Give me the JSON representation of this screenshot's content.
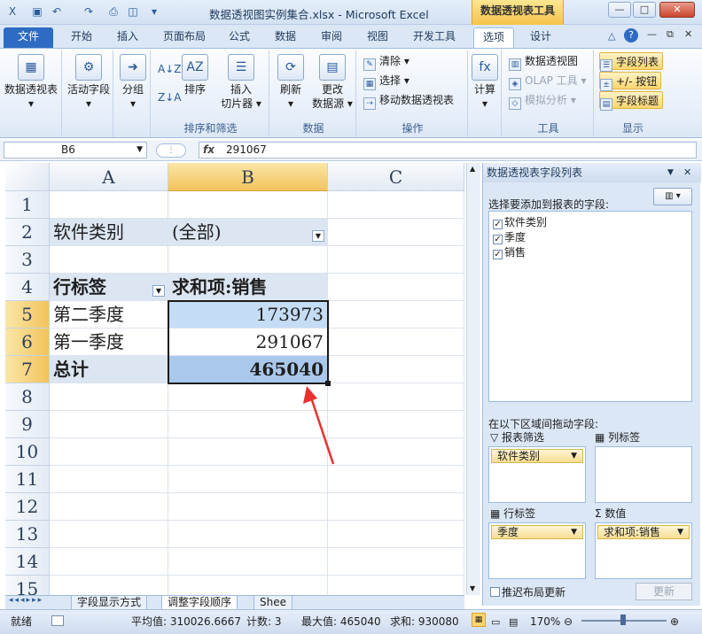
{
  "titlebar": {
    "title": "数据透视图实例集合.xlsx - Microsoft Excel",
    "context_tab": "数据透视表工具",
    "win_min": "—",
    "win_max": "□",
    "win_close": "✕"
  },
  "tabs": {
    "file": "文件",
    "home": "开始",
    "insert": "插入",
    "page_layout": "页面布局",
    "formulas": "公式",
    "data": "数据",
    "review": "审阅",
    "view": "视图",
    "developer": "开发工具",
    "options": "选项",
    "design": "设计"
  },
  "ribbon": {
    "pivottable": "数据透视表",
    "active_field": "活动字段",
    "group": "分组",
    "sort": "排序",
    "insert_slicer": [
      "插入",
      "切片器"
    ],
    "refresh": "刷新",
    "change_source": [
      "更改",
      "数据源"
    ],
    "clear": "清除",
    "select": "选择",
    "move_pivot": "移动数据透视表",
    "calculate": "计算",
    "pivotchart": "数据透视图",
    "olap": "OLAP 工具",
    "whatif": "模拟分析",
    "field_list": "字段列表",
    "buttons": "+/- 按钮",
    "field_headers": "字段标题",
    "grp_sort_filter": "排序和筛选",
    "grp_data": "数据",
    "grp_actions": "操作",
    "grp_tools": "工具",
    "grp_show": "显示"
  },
  "formula_bar": {
    "name_box": "B6",
    "fx": "fx",
    "value": "291067"
  },
  "grid": {
    "columns": [
      "A",
      "B",
      "C"
    ],
    "rows": [
      "1",
      "2",
      "3",
      "4",
      "5",
      "6",
      "7",
      "8",
      "9",
      "10",
      "11",
      "12",
      "13",
      "14",
      "15"
    ],
    "a2": "软件类别",
    "b2": "(全部)",
    "a4": "行标签",
    "b4": "求和项:销售",
    "a5": "第二季度",
    "b5": "173973",
    "a6": "第一季度",
    "b6": "291067",
    "a7": "总计",
    "b7": "465040"
  },
  "sheet_tabs": [
    "字段显示方式",
    "调整字段顺序",
    "Shee"
  ],
  "status": {
    "ready": "就绪",
    "average": "平均值: 310026.6667",
    "count": "计数: 3",
    "max": "最大值: 465040",
    "sum": "求和: 930080",
    "zoom": "170%"
  },
  "field_pane": {
    "title": "数据透视表字段列表",
    "choose": "选择要添加到报表的字段:",
    "fields": [
      "软件类别",
      "季度",
      "销售"
    ],
    "drag_label": "在以下区域间拖动字段:",
    "filter_label": "报表筛选",
    "column_label": "列标签",
    "row_label": "行标签",
    "values_label": "数值",
    "filter_chip": "软件类别",
    "row_chip": "季度",
    "values_chip": "求和项:销售",
    "defer": "推迟布局更新",
    "update": "更新"
  },
  "accent_colors": {
    "selection": "#f2c35b",
    "pivot_header": "#dce6f2",
    "arrow": "#e8312f"
  }
}
